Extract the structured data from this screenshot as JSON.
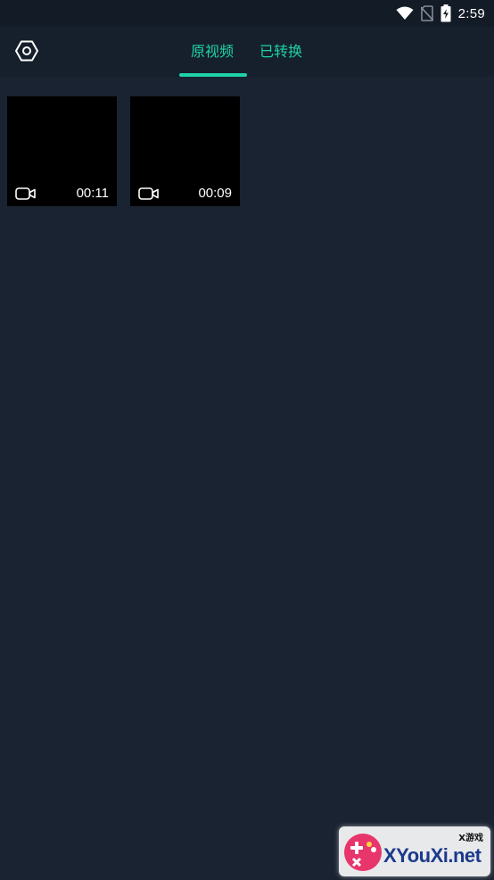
{
  "status_bar": {
    "time": "2:59",
    "icons": [
      "wifi-icon",
      "no-sim-icon",
      "battery-charging-icon"
    ]
  },
  "header": {
    "settings_icon": "settings-hexagon-icon",
    "tabs": [
      {
        "label": "原视频",
        "active": true
      },
      {
        "label": "已转换",
        "active": false
      }
    ],
    "accent_color": "#1fd1a8"
  },
  "videos": [
    {
      "duration": "00:11",
      "icon": "video-camera-icon"
    },
    {
      "duration": "00:09",
      "icon": "video-camera-icon"
    }
  ],
  "watermark": {
    "logo_text": "XYouXi.net",
    "tag": "X游戏"
  },
  "colors": {
    "background": "#1a2332",
    "header_background": "#16202c",
    "accent": "#1fd1a8"
  }
}
